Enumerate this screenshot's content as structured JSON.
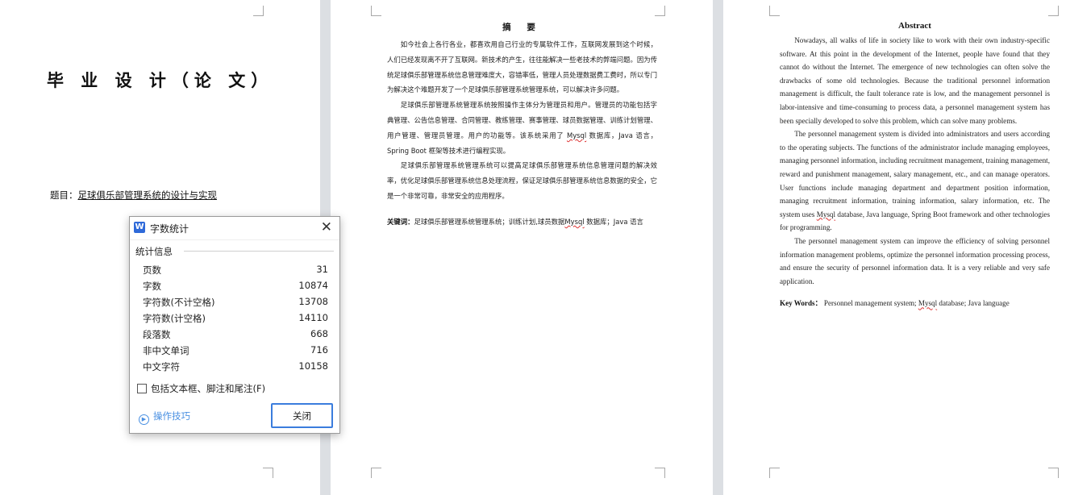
{
  "page1": {
    "thesis_title": "毕 业 设 计（论 文）",
    "topic_label": "题目：",
    "topic_value": "足球俱乐部管理系统的设计与实现"
  },
  "page2": {
    "heading": "摘  要",
    "paragraphs": [
      "如今社会上各行各业，都喜欢用自己行业的专属软件工作，互联网发展到这个时候，人们已经发现离不开了互联网。新技术的产生，往往能解决一些老技术的弊端问题。因为传统足球俱乐部管理系统信息管理难度大，容错率低，管理人员处理数据费工费时，所以专门为解决这个难题开发了一个足球俱乐部管理系统管理系统，可以解决许多问题。",
      "足球俱乐部管理系统管理系统按照操作主体分为管理员和用户。管理员的功能包括字典管理、公告信息管理、合同管理、教练管理、赛事管理、球员数据管理、训练计划管理、用户管理、管理员管理。用户的功能等。该系统采用了",
      "足球俱乐部管理系统管理系统可以提高足球俱乐部管理系统信息管理问题的解决效率，优化足球俱乐部管理系统信息处理流程，保证足球俱乐部管理系统信息数据的安全，它是一个非常可靠，非常安全的应用程序。"
    ],
    "p2_mysql": "Mysql",
    "p2_tail": "数据库，Java 语言，Spring Boot 框架等技术进行编程实现。",
    "keywords_label": "关键词：",
    "keywords_a": "足球俱乐部管理系统管理系统；训练计划,球员数据",
    "keywords_mysql": "Mysql",
    "keywords_b": "数据库；Java 语言"
  },
  "page3": {
    "heading": "Abstract",
    "p1": "Nowadays, all walks of life in society like to work with their own industry-specific software. At this point in the development of the Internet, people have found that they cannot do without the Internet. The emergence of new technologies can often solve the drawbacks of some old technologies. Because the traditional personnel information management is difficult, the fault tolerance rate is low, and the management personnel is labor-intensive and time-consuming to process data, a personnel management system has been specially developed to solve this problem, which can solve many problems.",
    "p2_a": "The personnel management system is divided into administrators and users according to the operating subjects. The functions of the administrator include managing employees, managing personnel information, including recruitment management, training management, reward and punishment management, salary management, etc., and can manage operators. User functions include managing department and department position information, managing recruitment information, training information, salary information, etc. The system uses",
    "p2_mysql": "Mysql",
    "p2_b": "database, Java language, Spring Boot framework and other technologies for programming.",
    "p3": "The personnel management system can improve the efficiency of solving personnel information management problems, optimize the personnel information processing process, and ensure the security of personnel information data. It is a very reliable and very safe application.",
    "keywords_label": "Key Words：",
    "keywords_a": "Personnel management system;",
    "keywords_mysql": "Mysql",
    "keywords_b": "database; Java language"
  },
  "dialog": {
    "icon_letter": "W",
    "title": "字数统计",
    "group_label": "统计信息",
    "stats": [
      {
        "label": "页数",
        "value": "31"
      },
      {
        "label": "字数",
        "value": "10874"
      },
      {
        "label": "字符数(不计空格)",
        "value": "13708"
      },
      {
        "label": "字符数(计空格)",
        "value": "14110"
      },
      {
        "label": "段落数",
        "value": "668"
      },
      {
        "label": "非中文单词",
        "value": "716"
      },
      {
        "label": "中文字符",
        "value": "10158"
      }
    ],
    "checkbox_label": "包括文本框、脚注和尾注(F)",
    "checkbox_checked": false,
    "tips_label": "操作技巧",
    "close_label": "关闭",
    "accent_color": "#3b7ddd"
  }
}
